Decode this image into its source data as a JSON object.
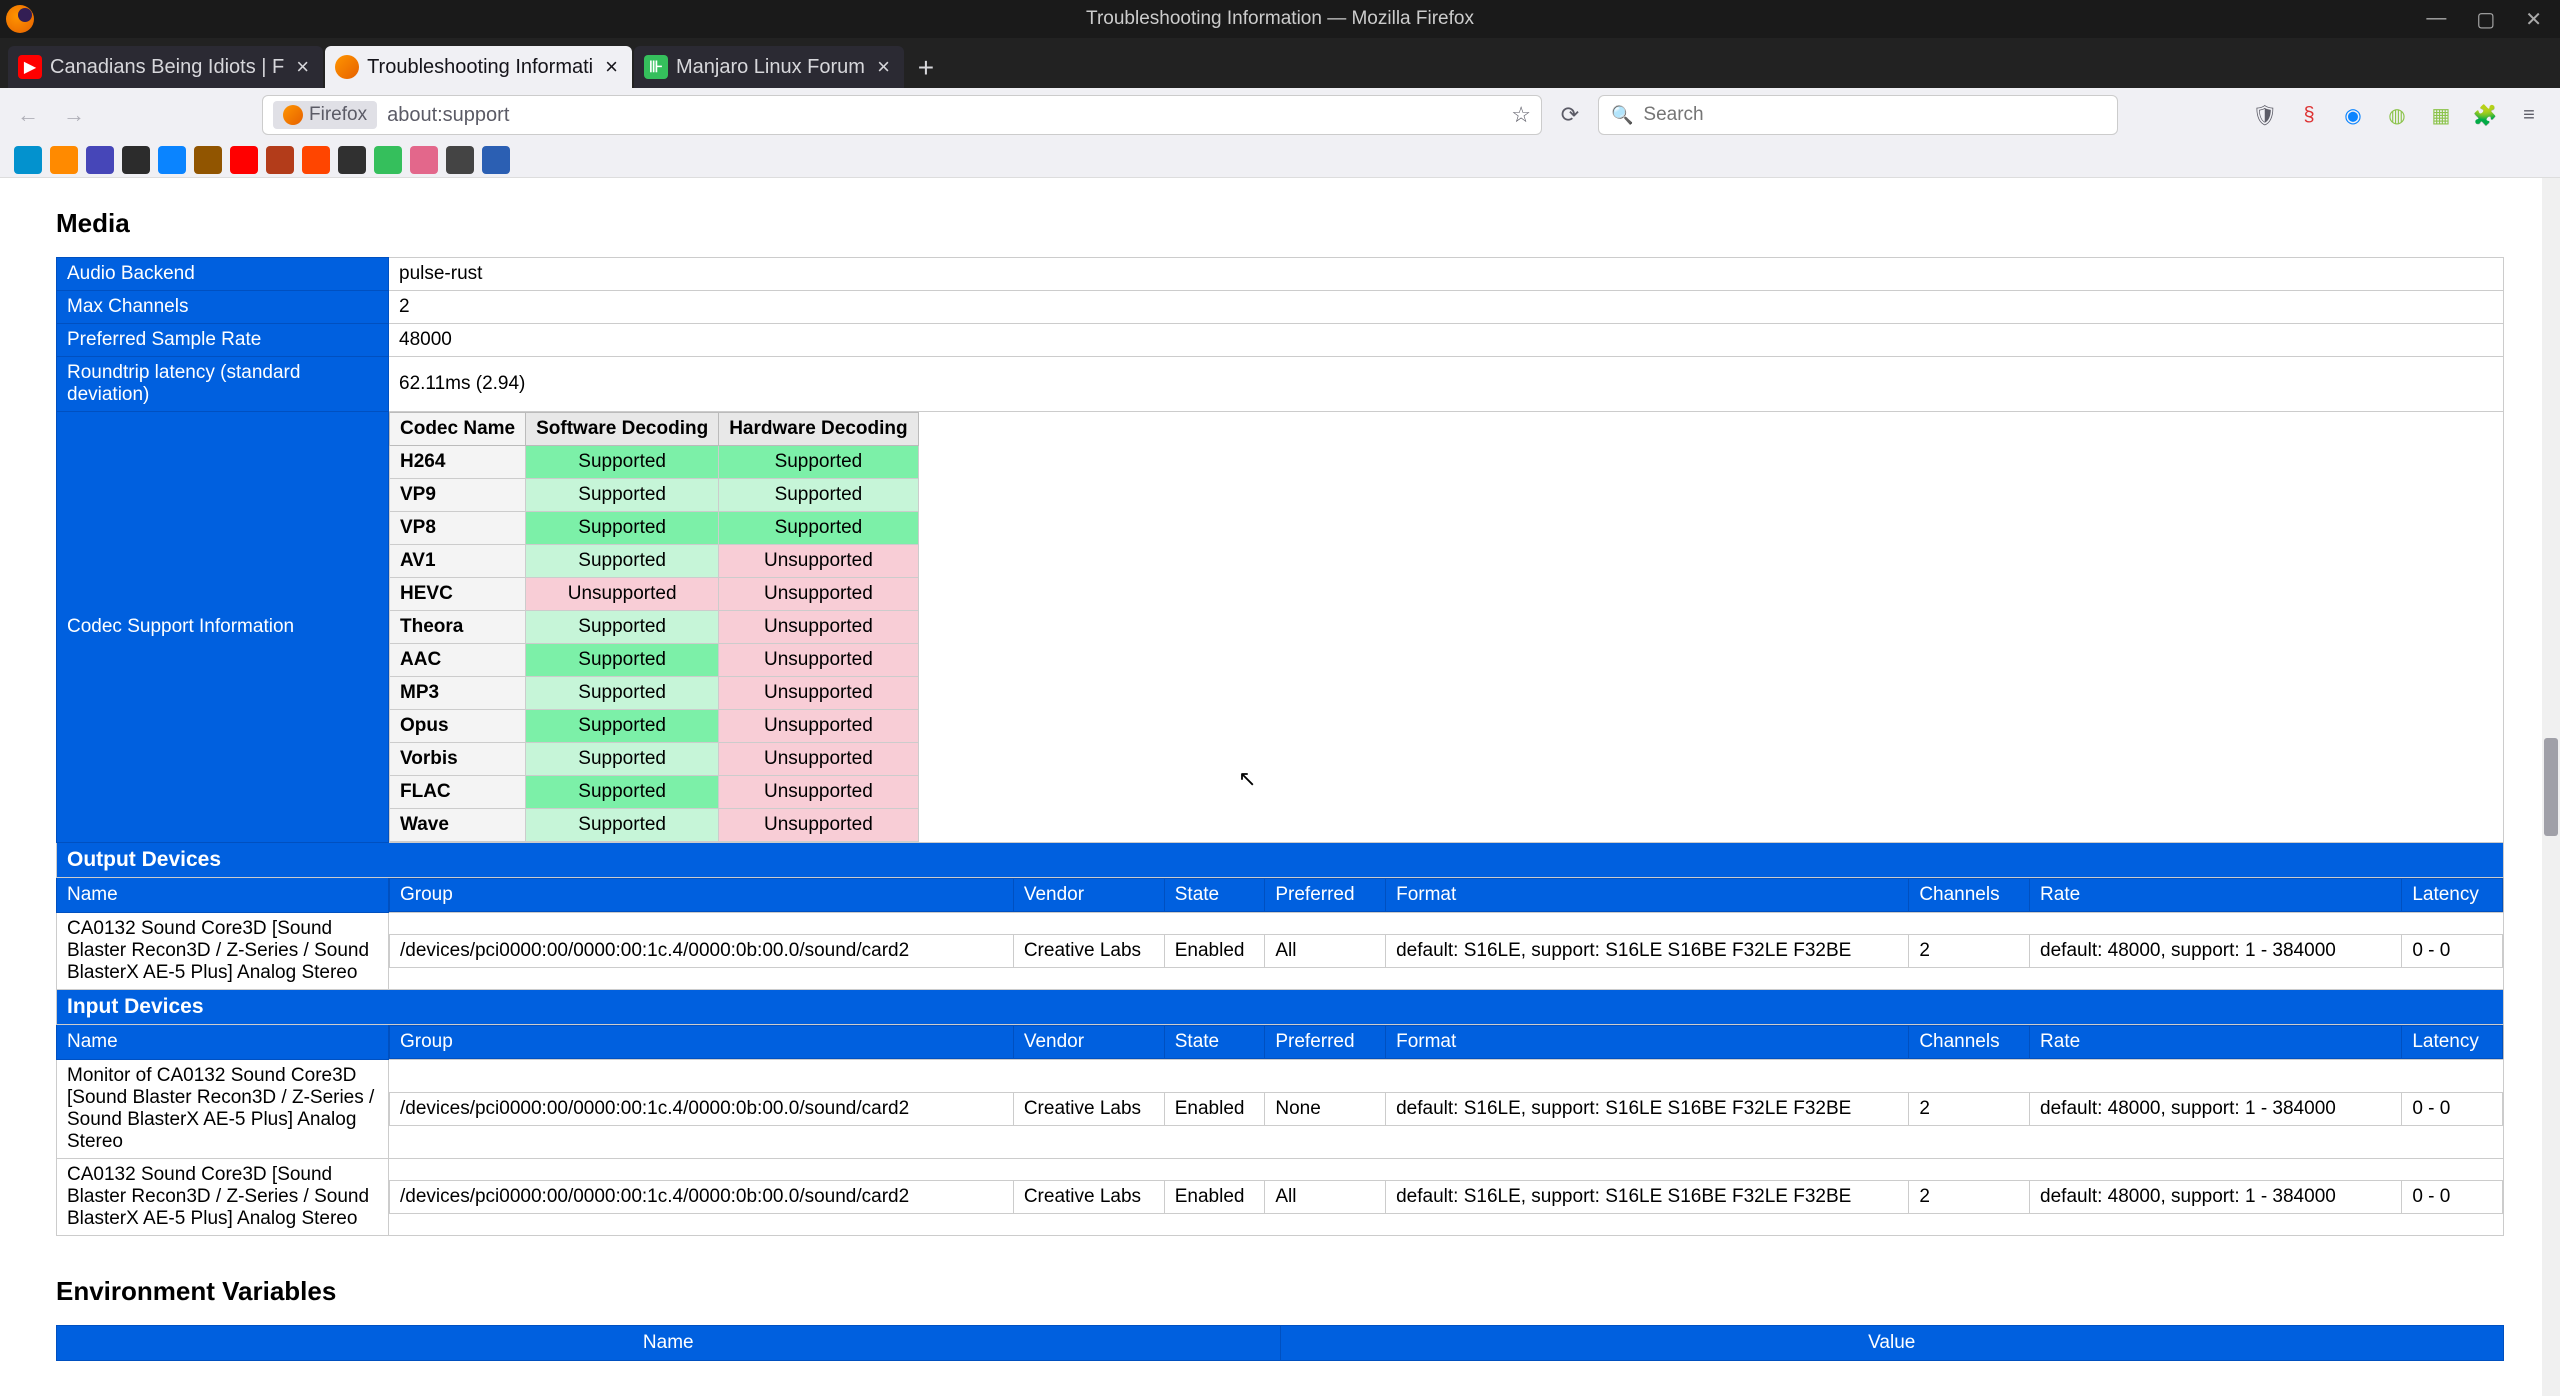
{
  "window": {
    "title": "Troubleshooting Information — Mozilla Firefox"
  },
  "tabs": [
    {
      "label": "Canadians Being Idiots | F",
      "favicon": "yt"
    },
    {
      "label": "Troubleshooting Informati",
      "favicon": "ff",
      "active": true
    },
    {
      "label": "Manjaro Linux Forum",
      "favicon": "mj"
    }
  ],
  "urlbar": {
    "identity": "Firefox",
    "url": "about:support"
  },
  "search": {
    "placeholder": "Search"
  },
  "bookmarks": [
    {
      "bg": "#0392ce"
    },
    {
      "bg": "#ff8a00"
    },
    {
      "bg": "#4646b8"
    },
    {
      "bg": "#2c2c2c"
    },
    {
      "bg": "#0a84ff"
    },
    {
      "bg": "#915500"
    },
    {
      "bg": "#ff0000"
    },
    {
      "bg": "#b33c1a"
    },
    {
      "bg": "#ff4500"
    },
    {
      "bg": "#303030"
    },
    {
      "bg": "#35bf5c"
    },
    {
      "bg": "#e3678b"
    },
    {
      "bg": "#444"
    },
    {
      "bg": "#2b5fb3"
    }
  ],
  "media": {
    "heading": "Media",
    "rows": {
      "audio_backend": {
        "label": "Audio Backend",
        "value": "pulse-rust"
      },
      "max_channels": {
        "label": "Max Channels",
        "value": "2"
      },
      "sample_rate": {
        "label": "Preferred Sample Rate",
        "value": "48000"
      },
      "latency": {
        "label": "Roundtrip latency (standard deviation)",
        "value": "62.11ms (2.94)"
      },
      "codec": {
        "label": "Codec Support Information"
      }
    },
    "codec_headers": {
      "name": "Codec Name",
      "sw": "Software Decoding",
      "hw": "Hardware Decoding"
    },
    "codecs": [
      {
        "name": "H264",
        "sw": "Supported",
        "sw_cls": "sup",
        "hw": "Supported",
        "hw_cls": "sup"
      },
      {
        "name": "VP9",
        "sw": "Supported",
        "sw_cls": "sup-alt",
        "hw": "Supported",
        "hw_cls": "sup-alt"
      },
      {
        "name": "VP8",
        "sw": "Supported",
        "sw_cls": "sup",
        "hw": "Supported",
        "hw_cls": "sup"
      },
      {
        "name": "AV1",
        "sw": "Supported",
        "sw_cls": "sup-alt",
        "hw": "Unsupported",
        "hw_cls": "unsup"
      },
      {
        "name": "HEVC",
        "sw": "Unsupported",
        "sw_cls": "unsup",
        "hw": "Unsupported",
        "hw_cls": "unsup"
      },
      {
        "name": "Theora",
        "sw": "Supported",
        "sw_cls": "sup-alt",
        "hw": "Unsupported",
        "hw_cls": "unsup"
      },
      {
        "name": "AAC",
        "sw": "Supported",
        "sw_cls": "sup",
        "hw": "Unsupported",
        "hw_cls": "unsup"
      },
      {
        "name": "MP3",
        "sw": "Supported",
        "sw_cls": "sup-alt",
        "hw": "Unsupported",
        "hw_cls": "unsup"
      },
      {
        "name": "Opus",
        "sw": "Supported",
        "sw_cls": "sup",
        "hw": "Unsupported",
        "hw_cls": "unsup"
      },
      {
        "name": "Vorbis",
        "sw": "Supported",
        "sw_cls": "sup-alt",
        "hw": "Unsupported",
        "hw_cls": "unsup"
      },
      {
        "name": "FLAC",
        "sw": "Supported",
        "sw_cls": "sup",
        "hw": "Unsupported",
        "hw_cls": "unsup"
      },
      {
        "name": "Wave",
        "sw": "Supported",
        "sw_cls": "sup-alt",
        "hw": "Unsupported",
        "hw_cls": "unsup"
      }
    ],
    "output_header": "Output Devices",
    "input_header": "Input Devices",
    "dev_cols": {
      "name": "Name",
      "group": "Group",
      "vendor": "Vendor",
      "state": "State",
      "preferred": "Preferred",
      "format": "Format",
      "channels": "Channels",
      "rate": "Rate",
      "latency": "Latency"
    },
    "output_devices": [
      {
        "name": "CA0132 Sound Core3D [Sound Blaster Recon3D / Z-Series / Sound BlasterX AE-5 Plus] Analog Stereo",
        "group": "/devices/pci0000:00/0000:00:1c.4/0000:0b:00.0/sound/card2",
        "vendor": "Creative Labs",
        "state": "Enabled",
        "preferred": "All",
        "format": "default: S16LE, support: S16LE S16BE F32LE F32BE",
        "channels": "2",
        "rate": "default: 48000, support: 1 - 384000",
        "latency": "0 - 0"
      }
    ],
    "input_devices": [
      {
        "name": "Monitor of CA0132 Sound Core3D [Sound Blaster Recon3D / Z-Series / Sound BlasterX AE-5 Plus] Analog Stereo",
        "group": "/devices/pci0000:00/0000:00:1c.4/0000:0b:00.0/sound/card2",
        "vendor": "Creative Labs",
        "state": "Enabled",
        "preferred": "None",
        "format": "default: S16LE, support: S16LE S16BE F32LE F32BE",
        "channels": "2",
        "rate": "default: 48000, support: 1 - 384000",
        "latency": "0 - 0"
      },
      {
        "name": "CA0132 Sound Core3D [Sound Blaster Recon3D / Z-Series / Sound BlasterX AE-5 Plus] Analog Stereo",
        "group": "/devices/pci0000:00/0000:00:1c.4/0000:0b:00.0/sound/card2",
        "vendor": "Creative Labs",
        "state": "Enabled",
        "preferred": "All",
        "format": "default: S16LE, support: S16LE S16BE F32LE F32BE",
        "channels": "2",
        "rate": "default: 48000, support: 1 - 384000",
        "latency": "0 - 0"
      }
    ]
  },
  "env": {
    "heading": "Environment Variables",
    "cols": {
      "name": "Name",
      "value": "Value"
    }
  }
}
